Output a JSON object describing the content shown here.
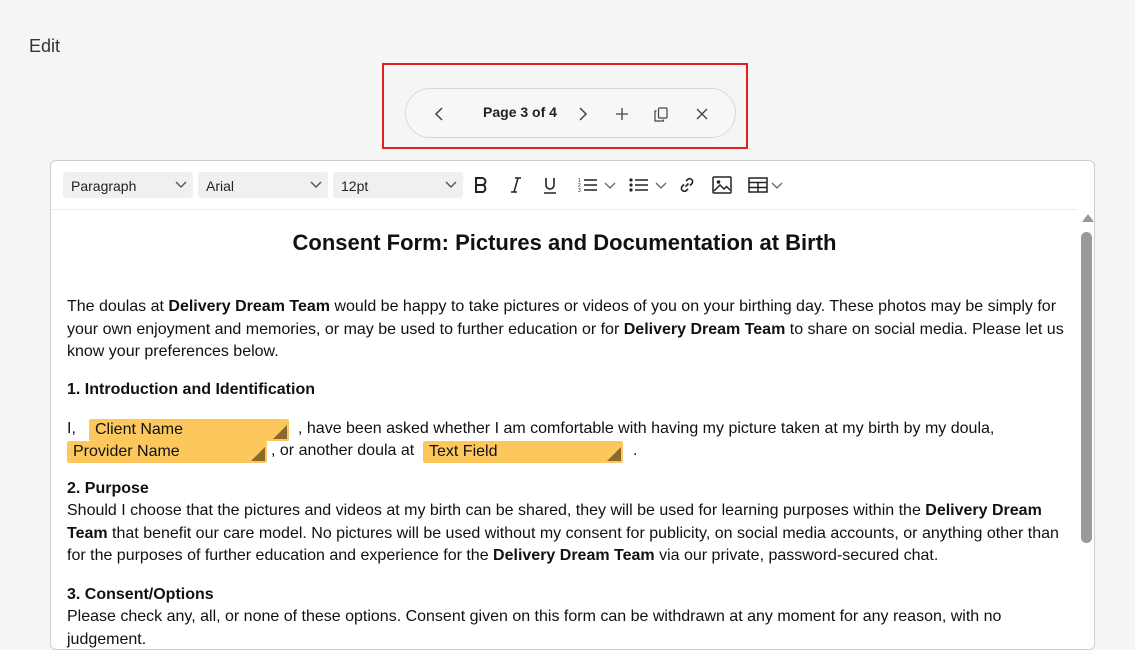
{
  "page": {
    "title": "Edit"
  },
  "page_nav": {
    "label": "Page 3 of 4"
  },
  "toolbar": {
    "block_format": "Paragraph",
    "font_family": "Arial",
    "font_size": "12pt"
  },
  "doc": {
    "title": "Consent Form: Pictures and Documentation at Birth",
    "intro": {
      "t1": "The doulas at ",
      "b1": "Delivery Dream Team",
      "t2": " would be happy to take pictures or videos of you on your birthing day. These photos may be simply for your own enjoyment and memories, or may be used to further education or for ",
      "b2": "Delivery Dream Team",
      "t3": " to share on social media. Please let us know your preferences below."
    },
    "section1_heading": "1. Introduction and Identification",
    "section1": {
      "t1": "I,",
      "field_client": "Client Name",
      "t2": ", have been asked whether I am comfortable with having my picture taken at my birth by my doula,",
      "field_provider": "Provider Name",
      "t3": ", or another doula at",
      "field_text": "Text Field",
      "t4": "."
    },
    "section2_heading": "2. Purpose",
    "section2": {
      "t1": "Should I choose that the pictures and videos at my birth can be shared, they will be used for learning purposes within the ",
      "b1": "Delivery Dream Team",
      "t2": " that benefit our care model. No pictures will be used without my consent for publicity, on social media accounts, or anything other than for the purposes of further education and experience for the ",
      "b2": "Delivery Dream Team",
      "t3": " via our private, password-secured chat."
    },
    "section3_heading": "3. Consent/Options",
    "section3": {
      "t1": "Please check any, all, or none of these options. Consent given on this form can be withdrawn at any moment for any reason, with no judgement."
    }
  }
}
